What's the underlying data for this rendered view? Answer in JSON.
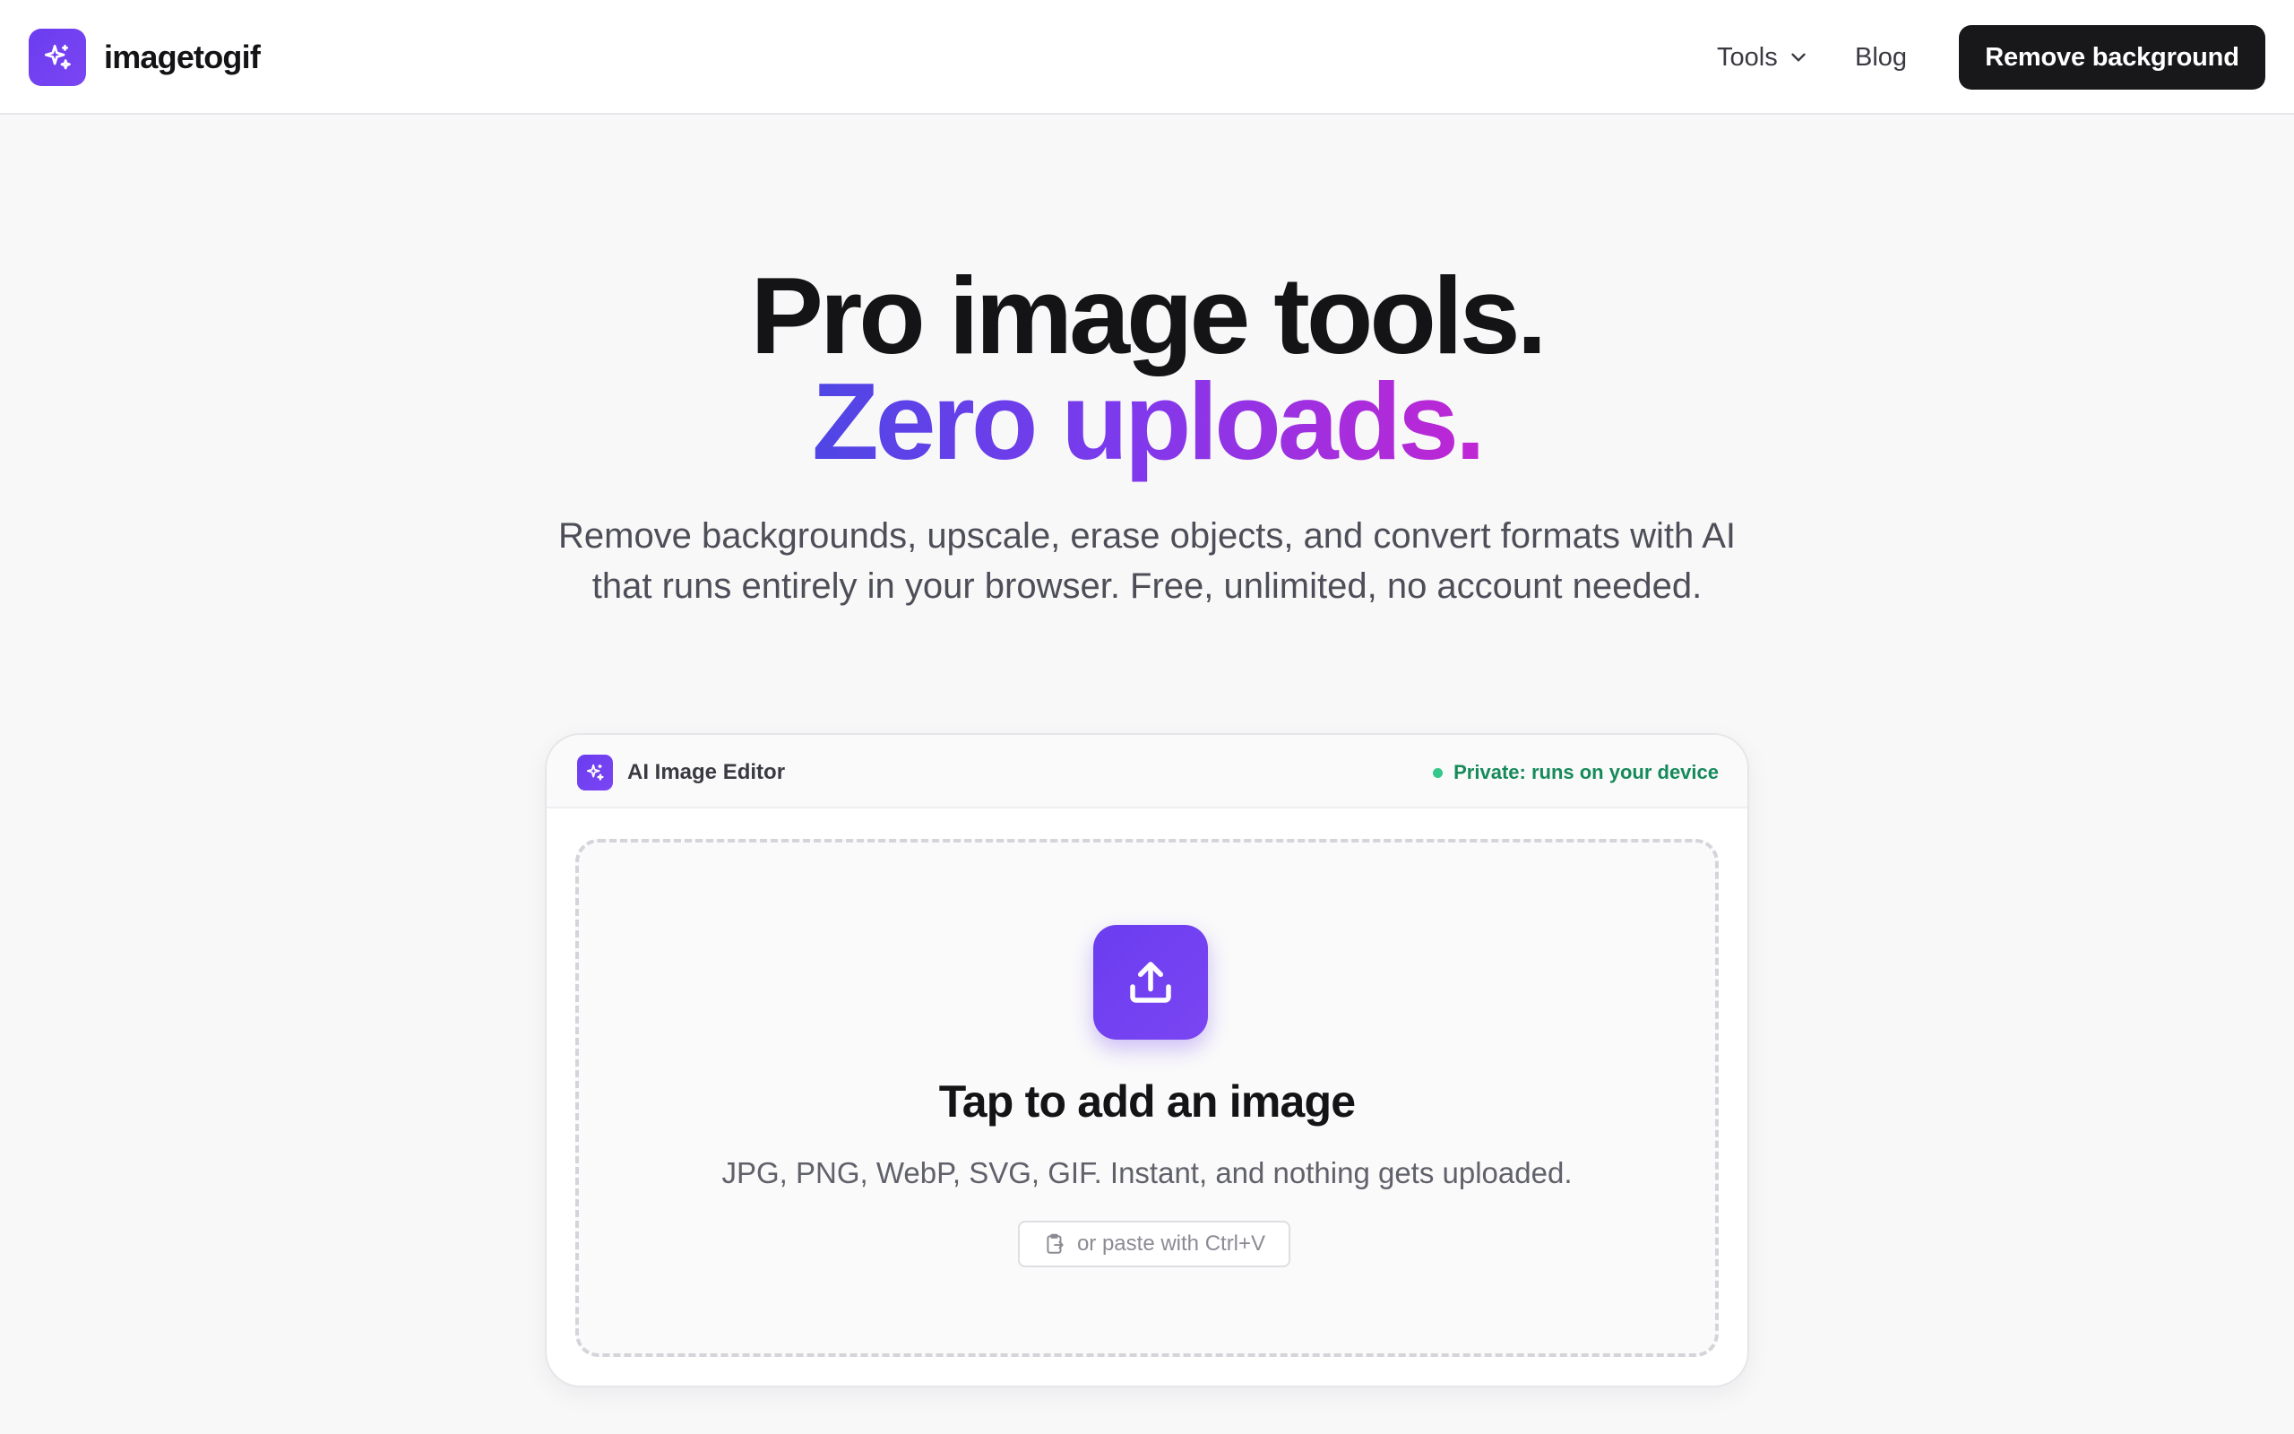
{
  "header": {
    "brand": "imagetogif",
    "nav": {
      "tools_label": "Tools",
      "blog_label": "Blog"
    },
    "cta_label": "Remove background"
  },
  "hero": {
    "line1": "Pro image tools.",
    "line2": "Zero uploads.",
    "subtitle": "Remove backgrounds, upscale, erase objects, and convert formats with AI that runs entirely in your browser. Free, unlimited, no account needed."
  },
  "editor": {
    "title": "AI Image Editor",
    "privacy_label": "Private: runs on your device",
    "dropzone": {
      "title": "Tap to add an image",
      "subtitle": "JPG, PNG, WebP, SVG, GIF. Instant, and nothing gets uploaded.",
      "paste_hint": "or paste with Ctrl+V"
    }
  },
  "icons": {
    "brand": "sparkles-icon",
    "tools_dropdown": "chevron-down-icon",
    "upload": "upload-icon",
    "paste": "clipboard-icon"
  },
  "colors": {
    "accent": "#6a3df0",
    "gradient_start": "#4f46e5",
    "gradient_end": "#c026d3",
    "cta_bg": "#18181b",
    "privacy_text": "#168a5a",
    "privacy_dot": "#34c98b"
  }
}
